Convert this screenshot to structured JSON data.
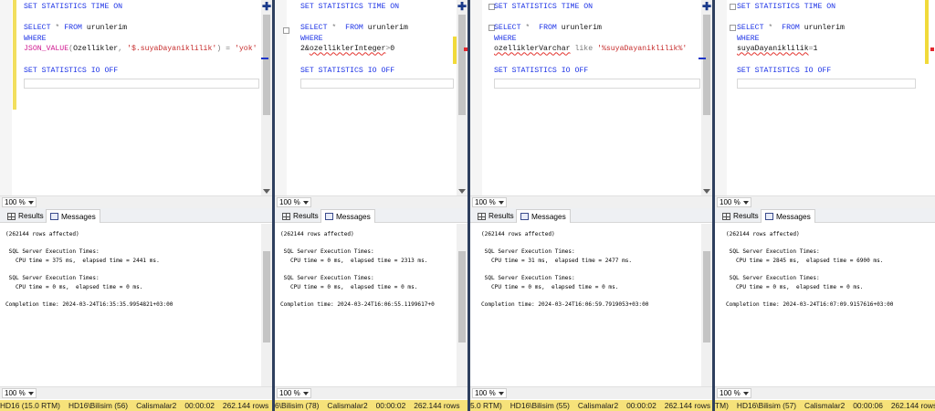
{
  "panels": [
    {
      "id": "p1",
      "code": [
        [
          {
            "t": "SET STATISTICS TIME ON",
            "c": "kw"
          }
        ],
        [],
        [
          {
            "t": "SELECT",
            "c": "kw"
          },
          {
            "t": " ",
            "c": "id"
          },
          {
            "t": "*",
            "c": "op"
          },
          {
            "t": " ",
            "c": "id"
          },
          {
            "t": "FROM",
            "c": "kw"
          },
          {
            "t": " urunlerim",
            "c": "id"
          }
        ],
        [
          {
            "t": "WHERE",
            "c": "kw"
          }
        ],
        [
          {
            "t": "JSON_VALUE",
            "c": "fn"
          },
          {
            "t": "(",
            "c": "op"
          },
          {
            "t": "Ozellikler",
            "c": "id"
          },
          {
            "t": ", ",
            "c": "op"
          },
          {
            "t": "'$.suyaDayaniklilik'",
            "c": "str"
          },
          {
            "t": ")",
            "c": "op"
          },
          {
            "t": " = ",
            "c": "op"
          },
          {
            "t": "'yok'",
            "c": "str"
          }
        ],
        [],
        [
          {
            "t": "SET STATISTICS IO OFF",
            "c": "kw"
          }
        ]
      ],
      "zoom_top": "100 %",
      "tab_results": "Results",
      "tab_messages": "Messages",
      "messages": "(262144 rows affected)\n\n SQL Server Execution Times:\n   CPU time = 375 ms,  elapsed time = 2441 ms.\n\n SQL Server Execution Times:\n   CPU time = 0 ms,  elapsed time = 0 ms.\n\nCompletion time: 2024-03-24T16:35:35.9954821+03:00",
      "zoom_bottom": "100 %",
      "status": [
        "HD16 (15.0 RTM)",
        "HD16\\Bilisim (56)",
        "Calismalar2",
        "00:00:02",
        "262.144 rows"
      ]
    },
    {
      "id": "p2",
      "code": [
        [
          {
            "t": "SET STATISTICS TIME ON",
            "c": "kw"
          }
        ],
        [],
        [
          {
            "t": "SELECT",
            "c": "kw"
          },
          {
            "t": " ",
            "c": "id"
          },
          {
            "t": "*",
            "c": "op"
          },
          {
            "t": "  ",
            "c": "id"
          },
          {
            "t": "FROM",
            "c": "kw"
          },
          {
            "t": " urunlerim",
            "c": "id"
          }
        ],
        [
          {
            "t": "WHERE",
            "c": "kw"
          }
        ],
        [
          {
            "t": "2&",
            "c": "id"
          },
          {
            "t": "ozelliklerInteger",
            "c": "sq"
          },
          {
            "t": ">",
            "c": "op"
          },
          {
            "t": "0",
            "c": "id"
          }
        ],
        [],
        [
          {
            "t": "SET STATISTICS IO OFF",
            "c": "kw"
          }
        ]
      ],
      "zoom_top": "100 %",
      "tab_results": "Results",
      "tab_messages": "Messages",
      "messages": "(262144 rows affected)\n\n SQL Server Execution Times:\n   CPU time = 0 ms,  elapsed time = 2313 ms.\n\n SQL Server Execution Times:\n   CPU time = 0 ms,  elapsed time = 0 ms.\n\nCompletion time: 2024-03-24T16:06:55.1199617+0",
      "zoom_bottom": "100 %",
      "status": [
        "6\\Bilisim (78)",
        "Calismalar2",
        "00:00:02",
        "262.144 rows"
      ]
    },
    {
      "id": "p3",
      "code": [
        [
          {
            "t": "SET STATISTICS TIME ON",
            "c": "kw"
          }
        ],
        [],
        [
          {
            "t": "SELECT",
            "c": "kw"
          },
          {
            "t": " ",
            "c": "id"
          },
          {
            "t": "*",
            "c": "op"
          },
          {
            "t": "  ",
            "c": "id"
          },
          {
            "t": "FROM",
            "c": "kw"
          },
          {
            "t": " urunlerim",
            "c": "id"
          }
        ],
        [
          {
            "t": "WHERE",
            "c": "kw"
          }
        ],
        [
          {
            "t": "ozelliklerVarchar",
            "c": "sq"
          },
          {
            "t": " ",
            "c": "id"
          },
          {
            "t": "like",
            "c": "op"
          },
          {
            "t": " ",
            "c": "id"
          },
          {
            "t": "'%suyaDayaniklilik%'",
            "c": "str"
          }
        ],
        [],
        [
          {
            "t": "SET STATISTICS IO OFF",
            "c": "kw"
          }
        ]
      ],
      "zoom_top": "100 %",
      "tab_results": "Results",
      "tab_messages": "Messages",
      "messages": "(262144 rows affected)\n\n SQL Server Execution Times:\n   CPU time = 31 ms,  elapsed time = 2477 ms.\n\n SQL Server Execution Times:\n   CPU time = 0 ms,  elapsed time = 0 ms.\n\nCompletion time: 2024-03-24T16:06:59.7919053+03:00",
      "zoom_bottom": "100 %",
      "status": [
        "5.0 RTM)",
        "HD16\\Bilisim (55)",
        "Calismalar2",
        "00:00:02",
        "262.144 rows"
      ]
    },
    {
      "id": "p4",
      "code": [
        [
          {
            "t": "SET STATISTICS TIME ON",
            "c": "kw"
          }
        ],
        [],
        [
          {
            "t": "SELECT",
            "c": "kw"
          },
          {
            "t": " ",
            "c": "id"
          },
          {
            "t": "*",
            "c": "op"
          },
          {
            "t": "  ",
            "c": "id"
          },
          {
            "t": "FROM",
            "c": "kw"
          },
          {
            "t": " urunlerim",
            "c": "id"
          }
        ],
        [
          {
            "t": "WHERE",
            "c": "kw"
          }
        ],
        [
          {
            "t": "suyaDayaniklilik",
            "c": "sq"
          },
          {
            "t": "=",
            "c": "op"
          },
          {
            "t": "1",
            "c": "id"
          }
        ],
        [],
        [
          {
            "t": "SET STATISTICS IO OFF",
            "c": "kw"
          }
        ]
      ],
      "zoom_top": "100 %",
      "tab_results": "Results",
      "tab_messages": "Messages",
      "messages": "(262144 rows affected)\n\n SQL Server Execution Times:\n   CPU time = 2845 ms,  elapsed time = 6900 ms.\n\n SQL Server Execution Times:\n   CPU time = 0 ms,  elapsed time = 0 ms.\n\nCompletion time: 2024-03-24T16:07:09.9157616+03:00",
      "zoom_bottom": "100 %",
      "status": [
        "TM)",
        "HD16\\Bilisim (57)",
        "Calismalar2",
        "00:00:06",
        "262.144 rows"
      ]
    }
  ],
  "icons": {
    "split": "split-plus-icon",
    "results": "grid-icon",
    "messages": "messages-icon"
  },
  "colors": {
    "keyword": "#1d33e6",
    "function": "#d01b91",
    "string": "#c62b2b",
    "statusbar": "#f6e27a",
    "divider": "#2e3f5e"
  }
}
